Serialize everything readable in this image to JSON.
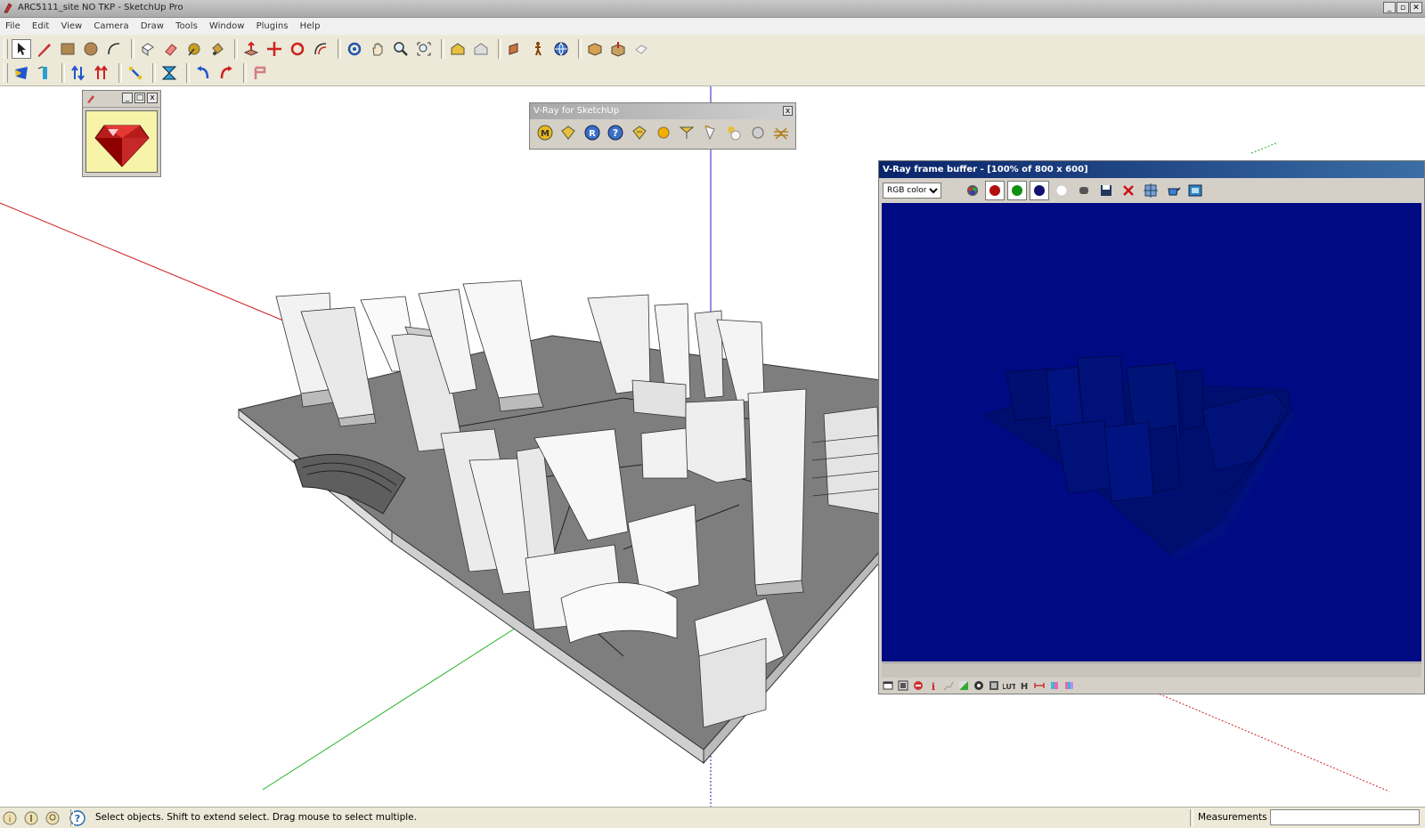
{
  "window": {
    "title": "ARC5111_site NO TKP - SketchUp Pro",
    "minimize": "_",
    "maximize": "▫",
    "close": "✕"
  },
  "menu": [
    "File",
    "Edit",
    "View",
    "Camera",
    "Draw",
    "Tools",
    "Window",
    "Plugins",
    "Help"
  ],
  "toolbar": {
    "row1": [
      "select-tool",
      "pencil-tool",
      "rectangle-tool",
      "circle-tool",
      "arc-tool",
      "eraser-tool",
      "paint-tool",
      "tape-measure-tool",
      "protractor-tool",
      "push-pull-tool",
      "move-tool",
      "rotate-tool",
      "offset-tool",
      "orbit-tool",
      "pan-tool",
      "zoom-tool",
      "zoom-extents-tool",
      "previous-view-tool",
      "section-plane-tool",
      "walk-tool",
      "position-camera-tool",
      "look-around-tool",
      "get-models-tool",
      "share-model-tool",
      "component-tool"
    ],
    "row2": [
      "sandbox-from-contours-tool",
      "sandbox-from-scratch-tool",
      "smoove-tool",
      "stamp-tool",
      "drape-tool",
      "add-detail-tool",
      "flip-edge-tool",
      "undo-tool",
      "redo-tool",
      "generate-report-tool"
    ]
  },
  "ruby_console": {
    "min": "_",
    "max": "□",
    "close": "x"
  },
  "vray_toolbar": {
    "title": "V-Ray for SketchUp",
    "close": "x",
    "buttons": [
      "material-editor",
      "options",
      "render",
      "help",
      "frame-buffer",
      "sphere-light",
      "spot-light",
      "ies-light",
      "omni-light",
      "dome-light",
      "infinite-plane"
    ]
  },
  "frame_buffer": {
    "title": "V-Ray frame buffer - [100% of 800 x 600]",
    "channel": "RGB color",
    "channel_options": [
      "RGB color"
    ]
  },
  "status": {
    "hint": "Select objects. Shift to extend select. Drag mouse to select multiple.",
    "measurements_label": "Measurements",
    "measurements_value": ""
  },
  "colors": {
    "red_axis": "#d02020",
    "green_axis": "#20b020",
    "blue_axis": "#2020c0",
    "render_bg": "#000a82"
  }
}
